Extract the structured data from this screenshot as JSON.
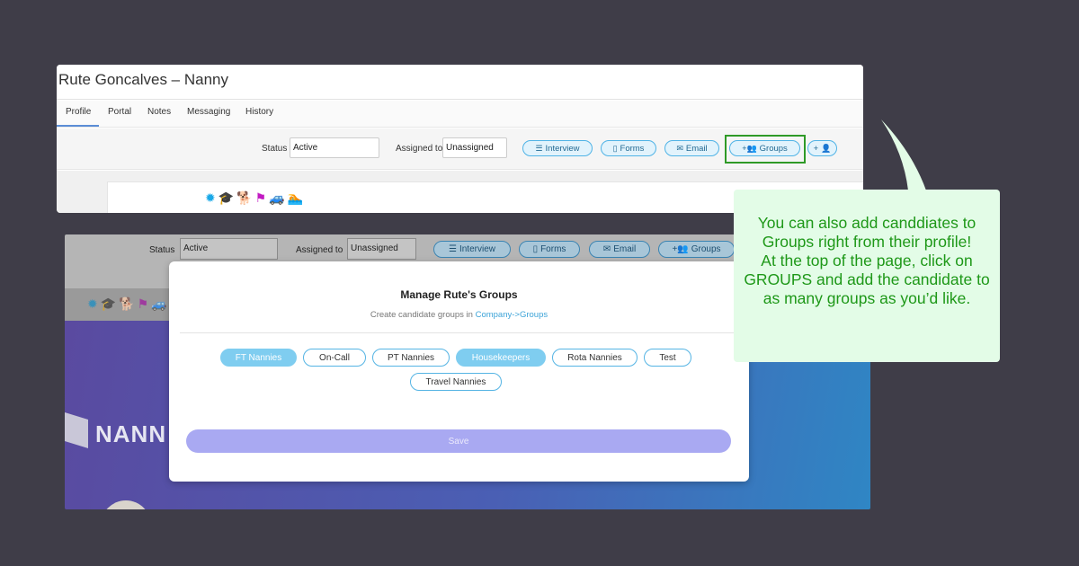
{
  "profile": {
    "title": "Rute Goncalves – Nanny",
    "tabs": [
      {
        "label": "Profile",
        "active": true
      },
      {
        "label": "Portal",
        "active": false
      },
      {
        "label": "Notes",
        "active": false
      },
      {
        "label": "Messaging",
        "active": false
      },
      {
        "label": "History",
        "active": false
      }
    ],
    "status_label": "Status",
    "status_value": "Active",
    "assigned_label": "Assigned to",
    "assigned_value": "Unassigned",
    "actions": {
      "interview": "Interview",
      "forms": "Forms",
      "email": "Email",
      "groups": "Groups",
      "add_user": "+"
    },
    "badge_icons": [
      "gear-badge-icon",
      "graduation-cap-icon",
      "dog-icon",
      "flag-icon",
      "car-icon",
      "swimmer-icon"
    ]
  },
  "background_page": {
    "status_label": "Status",
    "status_value": "Active",
    "assigned_label": "Assigned to",
    "assigned_value": "Unassigned",
    "actions": {
      "interview": "Interview",
      "forms": "Forms",
      "email": "Email",
      "groups": "Groups"
    },
    "logo_text": "NANN"
  },
  "modal": {
    "title": "Manage Rute's Groups",
    "subtitle_prefix": "Create candidate groups in ",
    "subtitle_link": "Company->Groups",
    "groups": [
      {
        "label": "FT Nannies",
        "selected": true
      },
      {
        "label": "On-Call",
        "selected": false
      },
      {
        "label": "PT Nannies",
        "selected": false
      },
      {
        "label": "Housekeepers",
        "selected": true
      },
      {
        "label": "Rota Nannies",
        "selected": false
      },
      {
        "label": "Test",
        "selected": false
      },
      {
        "label": "Travel Nannies",
        "selected": false
      }
    ],
    "save_label": "Save"
  },
  "callout": {
    "text": "You can also add canddiates to Groups right from their profile!\nAt the top of the page, click on GROUPS and add the candidate to as many groups as you’d like."
  },
  "colors": {
    "background": "#3f3d48",
    "accent": "#4fb3e6",
    "highlight": "#2f9a27",
    "callout_bg": "#e3fce7",
    "callout_text": "#1e9818",
    "save_button": "#a9a9f2"
  }
}
